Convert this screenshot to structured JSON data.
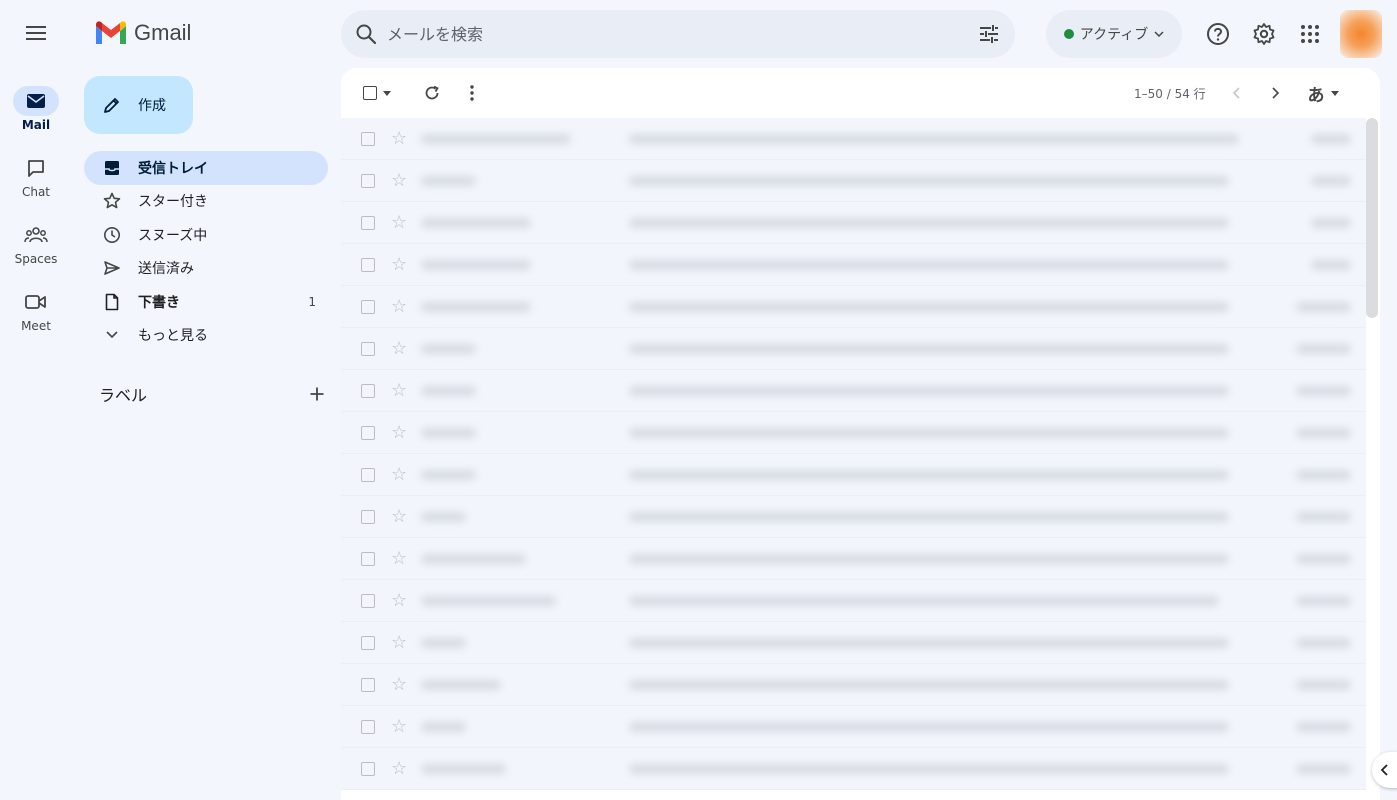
{
  "app": {
    "brand": "Gmail"
  },
  "rail": {
    "items": [
      {
        "label": "Mail",
        "icon": "mail-icon",
        "active": true
      },
      {
        "label": "Chat",
        "icon": "chat-icon",
        "active": false
      },
      {
        "label": "Spaces",
        "icon": "spaces-icon",
        "active": false
      },
      {
        "label": "Meet",
        "icon": "meet-icon",
        "active": false
      }
    ]
  },
  "search": {
    "placeholder": "メールを検索"
  },
  "status": {
    "label": "アクティブ",
    "color": "#1e8e3e"
  },
  "compose": {
    "label": "作成"
  },
  "nav": {
    "items": [
      {
        "label": "受信トレイ",
        "icon": "inbox-icon",
        "active": true,
        "count": ""
      },
      {
        "label": "スター付き",
        "icon": "star-icon",
        "active": false,
        "count": ""
      },
      {
        "label": "スヌーズ中",
        "icon": "clock-icon",
        "active": false,
        "count": ""
      },
      {
        "label": "送信済み",
        "icon": "send-icon",
        "active": false,
        "count": ""
      },
      {
        "label": "下書き",
        "icon": "draft-icon",
        "active": false,
        "count": "1"
      },
      {
        "label": "もっと見る",
        "icon": "chevron-down-icon",
        "active": false,
        "count": ""
      }
    ]
  },
  "labels": {
    "title": "ラベル"
  },
  "toolbar": {
    "pager": "1–50 / 54 行",
    "input_tool": "あ"
  },
  "colors": {
    "accent": "#c2e7ff",
    "active_nav": "#d3e3fd",
    "background": "#f3f6fc"
  }
}
